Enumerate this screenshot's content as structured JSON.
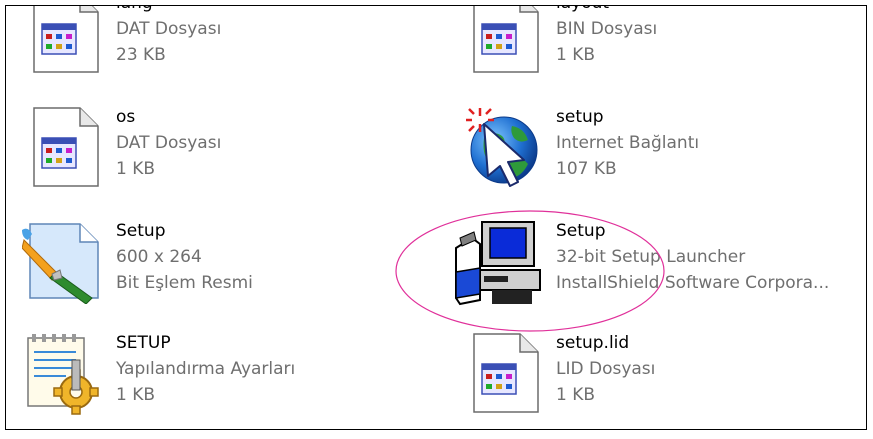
{
  "files": [
    {
      "name": "lang",
      "type": "DAT Dosyası",
      "size": "23 KB",
      "icon": "dat-file-icon"
    },
    {
      "name": "layout",
      "type": "BIN Dosyası",
      "size": "1 KB",
      "icon": "bin-file-icon"
    },
    {
      "name": "os",
      "type": "DAT Dosyası",
      "size": "1 KB",
      "icon": "dat-file-icon"
    },
    {
      "name": "setup",
      "type": "Internet Bağlantı",
      "size": "107 KB",
      "icon": "internet-shortcut-icon"
    },
    {
      "name": "Setup",
      "type": "600 x 264",
      "size": "Bit Eşlem Resmi",
      "icon": "bitmap-image-icon"
    },
    {
      "name": "Setup",
      "type": "32-bit Setup Launcher",
      "size": "InstallShield Software Corpora...",
      "icon": "installshield-setup-icon"
    },
    {
      "name": "SETUP",
      "type": "Yapılandırma Ayarları",
      "size": "1 KB",
      "icon": "config-settings-icon"
    },
    {
      "name": "setup.lid",
      "type": "LID Dosyası",
      "size": "1 KB",
      "icon": "lid-file-icon"
    }
  ],
  "colors": {
    "highlight_ellipse": "#e0309a",
    "name_text": "#000000",
    "detail_text": "#6f6f6f"
  }
}
